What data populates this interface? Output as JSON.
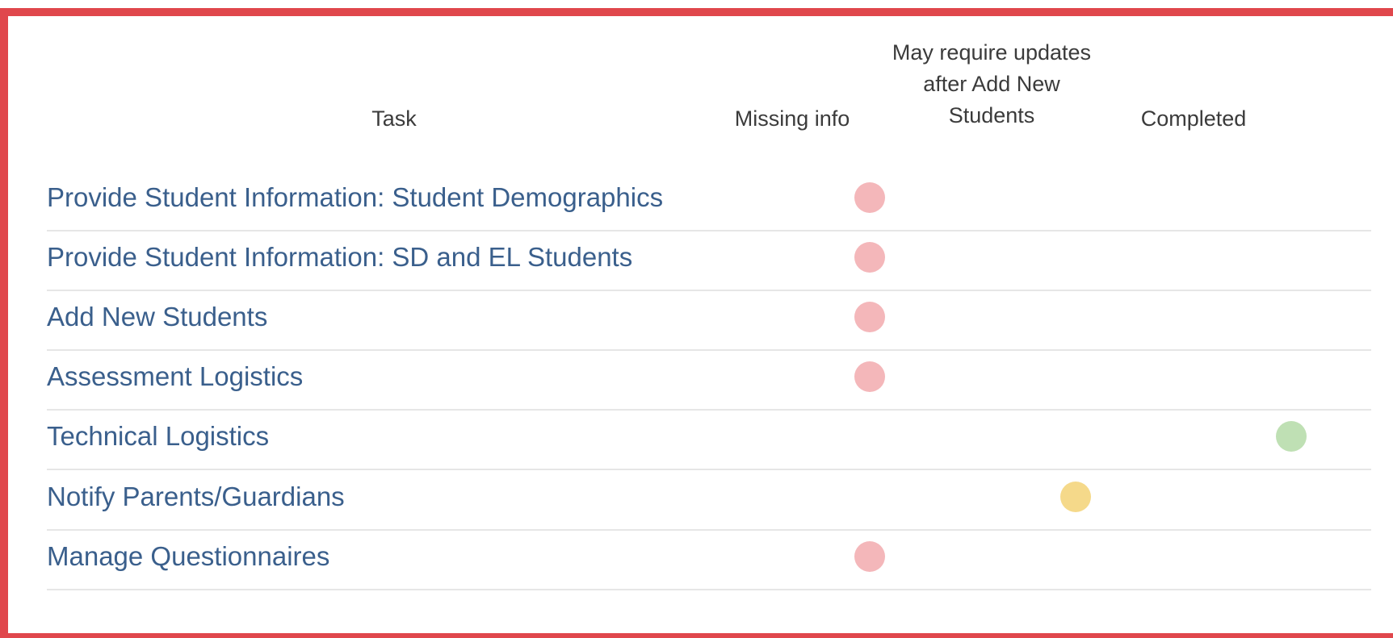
{
  "header": {
    "task": "Task",
    "missing": "Missing info",
    "may_line1": "May require updates",
    "may_line2": "after Add New",
    "may_line3": "Students",
    "completed": "Completed"
  },
  "colors": {
    "missing": "#f4b7ba",
    "may": "#f5d98a",
    "completed": "#bfe0b4",
    "link": "#3a5f8c",
    "border": "#e0474c"
  },
  "rows": [
    {
      "label": "Provide Student Information: Student Demographics",
      "status": "missing"
    },
    {
      "label": "Provide Student Information: SD and EL Students",
      "status": "missing"
    },
    {
      "label": "Add New Students",
      "status": "missing"
    },
    {
      "label": "Assessment Logistics",
      "status": "missing"
    },
    {
      "label": "Technical Logistics",
      "status": "completed"
    },
    {
      "label": "Notify Parents/Guardians",
      "status": "may"
    },
    {
      "label": "Manage Questionnaires",
      "status": "missing"
    }
  ]
}
